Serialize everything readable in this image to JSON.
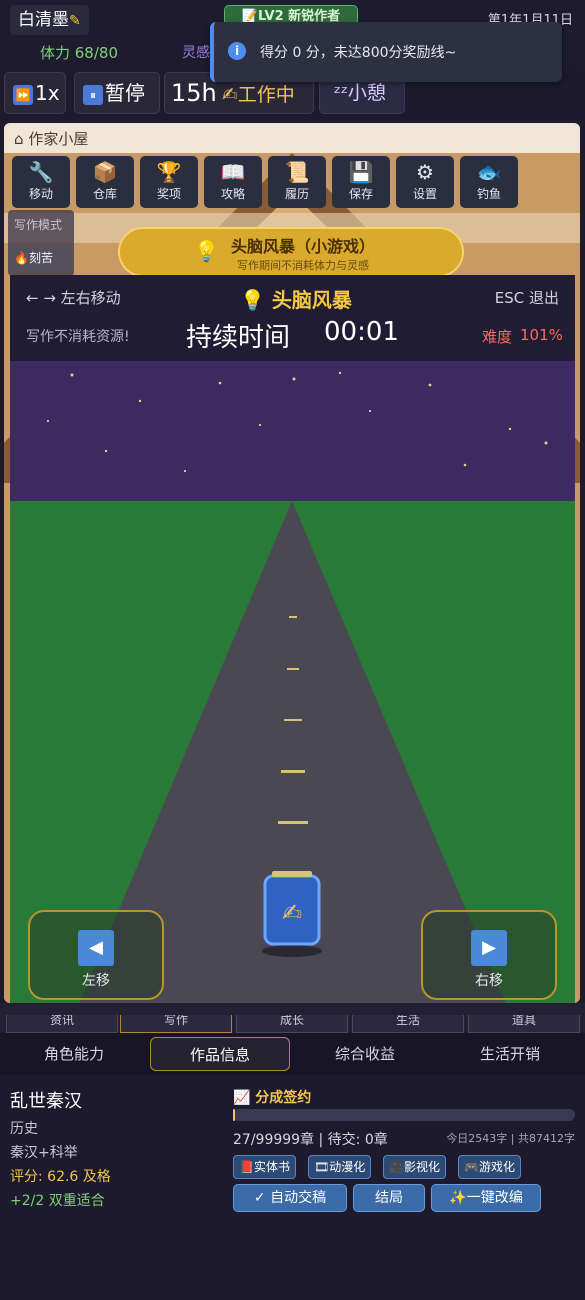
{
  "topbar": {
    "player_name": "白清墨",
    "edit_icon": "pencil-icon",
    "level": "📝LV2 新锐作者",
    "date": "第1年1月11日",
    "stamina": "体力 68/80",
    "inspiration_label": "灵感"
  },
  "toast": {
    "icon": "i",
    "message": "得分 0 分，未达800分奖励线~"
  },
  "controls": {
    "speed_icon": "⏩",
    "speed": "1x",
    "pause_icon": "⏸",
    "pause": "暂停",
    "hours": "15h",
    "working": "✍工作中",
    "rest": "ᶻᶻ小憩"
  },
  "house": {
    "title": "作家小屋",
    "tools": [
      {
        "glyph": "🔧",
        "label": "移动"
      },
      {
        "glyph": "📦",
        "label": "仓库"
      },
      {
        "glyph": "🏆",
        "label": "奖项"
      },
      {
        "glyph": "📖",
        "label": "攻略"
      },
      {
        "glyph": "📜",
        "label": "履历"
      },
      {
        "glyph": "💾",
        "label": "保存"
      },
      {
        "glyph": "⚙",
        "label": "设置"
      },
      {
        "glyph": "🐟",
        "label": "钓鱼"
      }
    ],
    "mode_label": "写作模式",
    "mode_value": "🔥刻苦",
    "brain_title": "头脑风暴（小游戏）",
    "brain_sub": "写作期间不消耗体力与灵感"
  },
  "game": {
    "move_hint": "← → 左右移动",
    "title": "💡 头脑风暴",
    "esc_hint": "ESC 退出",
    "no_cost": "写作不消耗资源!",
    "duration_label": "持续时间",
    "duration": "00:01",
    "difficulty_label": "难度",
    "difficulty": "101%",
    "player_glyph": "✍",
    "left_arrow": "◀",
    "left_label": "左移",
    "right_arrow": "▶",
    "right_label": "右移",
    "colors": {
      "sky": "#3d2a63",
      "grass": "#2a7a37",
      "road": "#4a4852"
    }
  },
  "main_tabs": [
    "资讯",
    "写作",
    "成长",
    "生活",
    "道具"
  ],
  "sub_tabs": [
    "角色能力",
    "作品信息",
    "综合收益",
    "生活开销"
  ],
  "novel": {
    "title": "乱世秦汉",
    "genre": "历史",
    "tags": "秦汉+科举",
    "score": "评分: 62.6 及格",
    "fit": "+2/2 双重适合",
    "contract": "📈 分成签约",
    "progress": 0.0003,
    "chapters": "27/99999章 | 待交: 0章",
    "words": "今日2543字 | 共87412字",
    "adaptations": [
      "📕实体书",
      "🎞动漫化",
      "🎥影视化",
      "🎮游戏化"
    ],
    "actions": [
      "✓ 自动交稿",
      "结局",
      "✨一键改编"
    ]
  }
}
